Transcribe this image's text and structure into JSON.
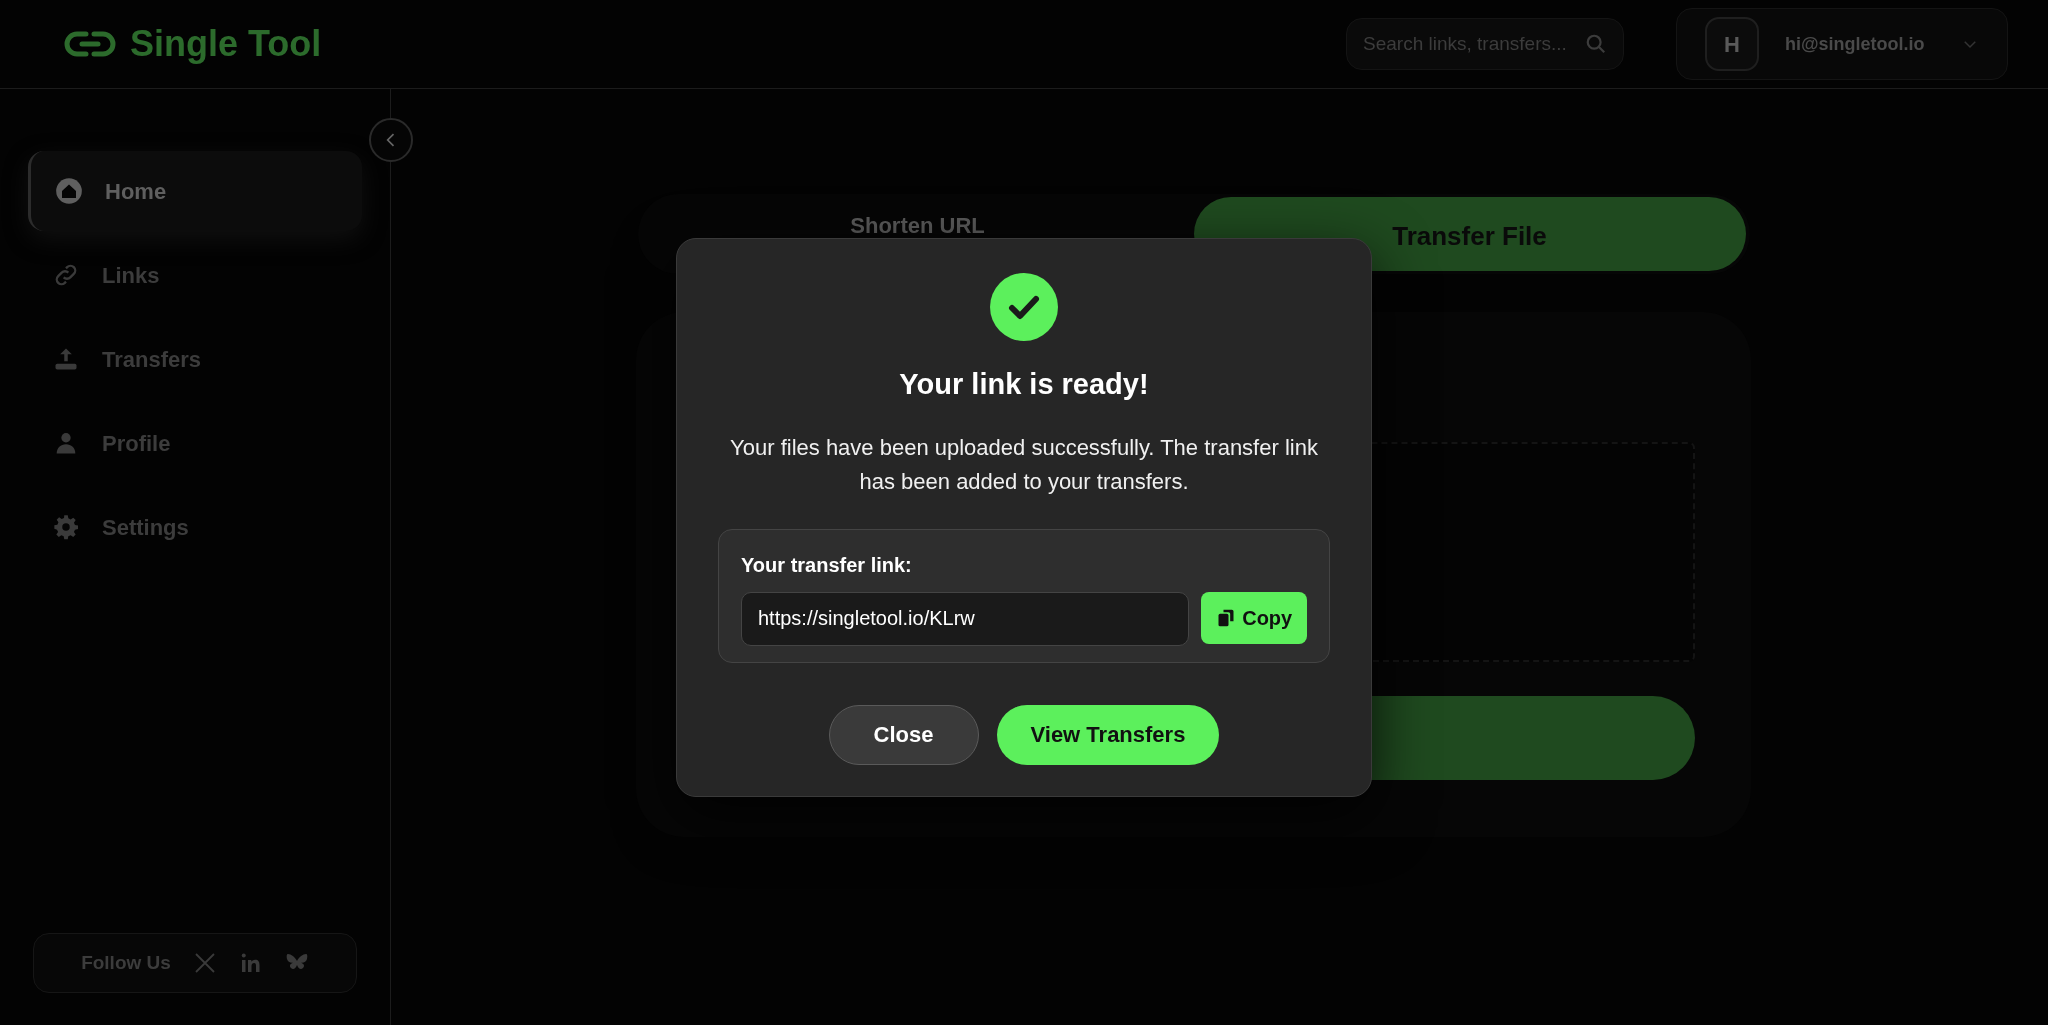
{
  "header": {
    "logo": "Single Tool",
    "search": {
      "placeholder": "Search links, transfers..."
    },
    "user": {
      "initial": "H",
      "email": "hi@singletool.io"
    }
  },
  "sidebar": {
    "items": [
      {
        "label": "Home",
        "kind": "home",
        "selected": true
      },
      {
        "label": "Links",
        "kind": "links",
        "selected": false
      },
      {
        "label": "Transfers",
        "kind": "transfers",
        "selected": false
      },
      {
        "label": "Profile",
        "kind": "profile",
        "selected": false
      },
      {
        "label": "Settings",
        "kind": "settings",
        "selected": false
      }
    ],
    "follow": {
      "label": "Follow Us",
      "networks": [
        {
          "kind": "x"
        },
        {
          "kind": "linkedin"
        },
        {
          "kind": "butterfly"
        }
      ]
    }
  },
  "tabs": [
    {
      "label": "Shorten URL",
      "selected": false
    },
    {
      "label": "Transfer File",
      "selected": true
    }
  ],
  "modal": {
    "title": "Your link is ready!",
    "message": "Your files have been uploaded successfully. The transfer link has been added to your transfers.",
    "link_label": "Your transfer link:",
    "link_value": "https://singletool.io/KLrw",
    "copy_label": "Copy",
    "buttons": [
      {
        "label": "Close",
        "kind": "secondary"
      },
      {
        "label": "View Transfers",
        "kind": "primary"
      }
    ]
  }
}
